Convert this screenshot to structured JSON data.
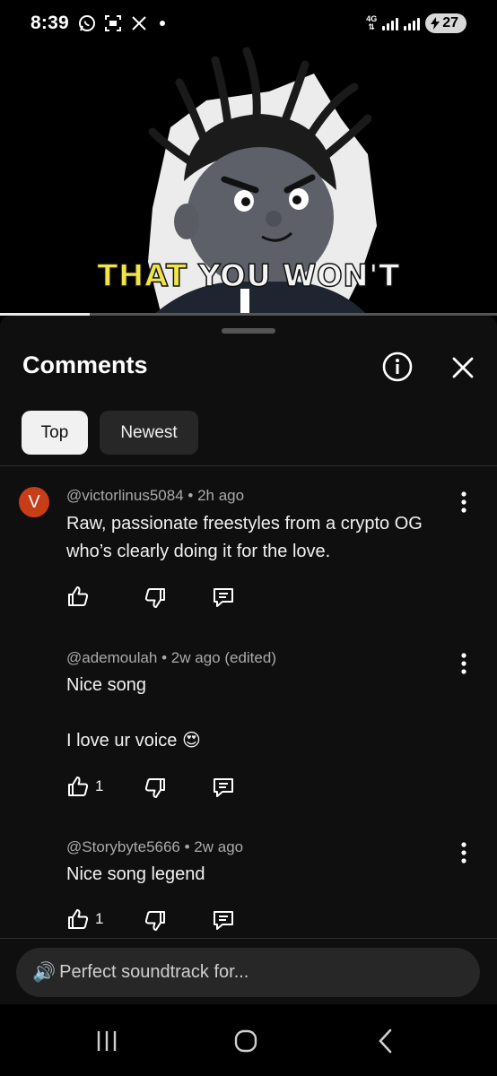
{
  "status_bar": {
    "time": "8:39",
    "icons_left": [
      "whatsapp-icon",
      "screenshot-icon",
      "x-icon"
    ],
    "network": "4G",
    "battery": "27"
  },
  "video": {
    "caption_word1": "THAT",
    "caption_rest": " YOU WON'T",
    "progress": 0.18
  },
  "comments_sheet": {
    "title": "Comments",
    "filters": [
      {
        "label": "Top",
        "selected": true
      },
      {
        "label": "Newest",
        "selected": false
      }
    ],
    "comments": [
      {
        "avatar_letter": "V",
        "avatar_color": "#c63d17",
        "author": "@victorlinus5084",
        "time": "2h ago",
        "text_lines": [
          "Raw, passionate freestyles from a crypto OG",
          "who’s clearly doing it for the love."
        ],
        "likes": ""
      },
      {
        "author": "@ademoulah",
        "time": "2w ago (edited)",
        "text_line1": "Nice song",
        "text_line2": "I love ur voice",
        "text_emoji": "😍",
        "likes": "1"
      },
      {
        "author": "@Storybyte5666",
        "time": "2w ago",
        "text": "Nice song legend",
        "likes": "1"
      }
    ],
    "input": {
      "emoji": "🔊",
      "placeholder": "Perfect soundtrack for..."
    }
  },
  "nav_bar": [
    "recent-apps",
    "home",
    "back"
  ]
}
